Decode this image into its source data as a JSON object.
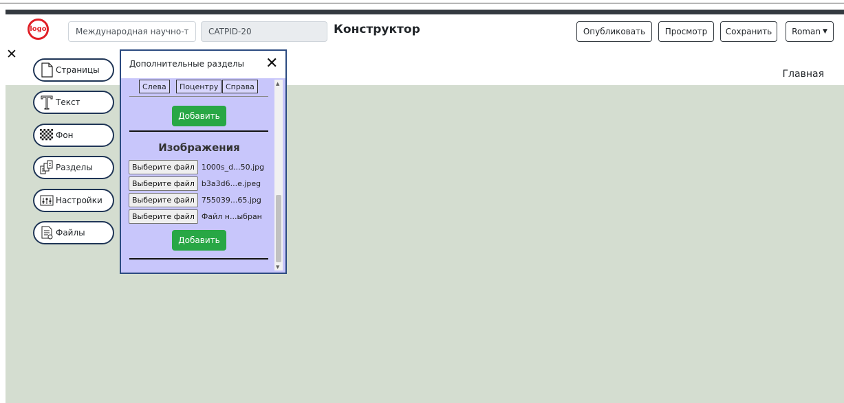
{
  "header": {
    "logo_text": "logo",
    "name_input_value": "Международная научно-те",
    "code_input_value": "CATPID-20",
    "title": "Конструктор",
    "publish_label": "Опубликовать",
    "preview_label": "Просмотр",
    "save_label": "Сохранить",
    "user_label": "Roman"
  },
  "close_symbol": "✕",
  "nav": {
    "home_label": "Главная"
  },
  "toolbar": {
    "items": [
      {
        "label": "Страницы",
        "icon": "page-icon"
      },
      {
        "label": "Текст",
        "icon": "text-icon"
      },
      {
        "label": "Фон",
        "icon": "background-checker-icon"
      },
      {
        "label": "Разделы",
        "icon": "sections-icon"
      },
      {
        "label": "Настройки",
        "icon": "settings-icon"
      },
      {
        "label": "Файлы",
        "icon": "files-icon"
      }
    ]
  },
  "panel": {
    "title": "Дополнительные разделы",
    "close_symbol": "✕",
    "align_buttons": [
      "Слева",
      "Поцентру",
      "Справа"
    ],
    "add_label": "Добавить",
    "images_title": "Изображения",
    "file_button_label": "Выберите файл",
    "files": [
      "1000s_d...50.jpg",
      "b3a3d6...e.jpeg",
      "755039...65.jpg",
      "Файл н...ыбран"
    ],
    "add_label_2": "Добавить"
  },
  "colors": {
    "logo_red": "#e01f26",
    "panel_bg": "#c8c6fb",
    "canvas_bg": "#d4ddd0",
    "add_green": "#28a745",
    "pill_border": "#1f3556"
  }
}
